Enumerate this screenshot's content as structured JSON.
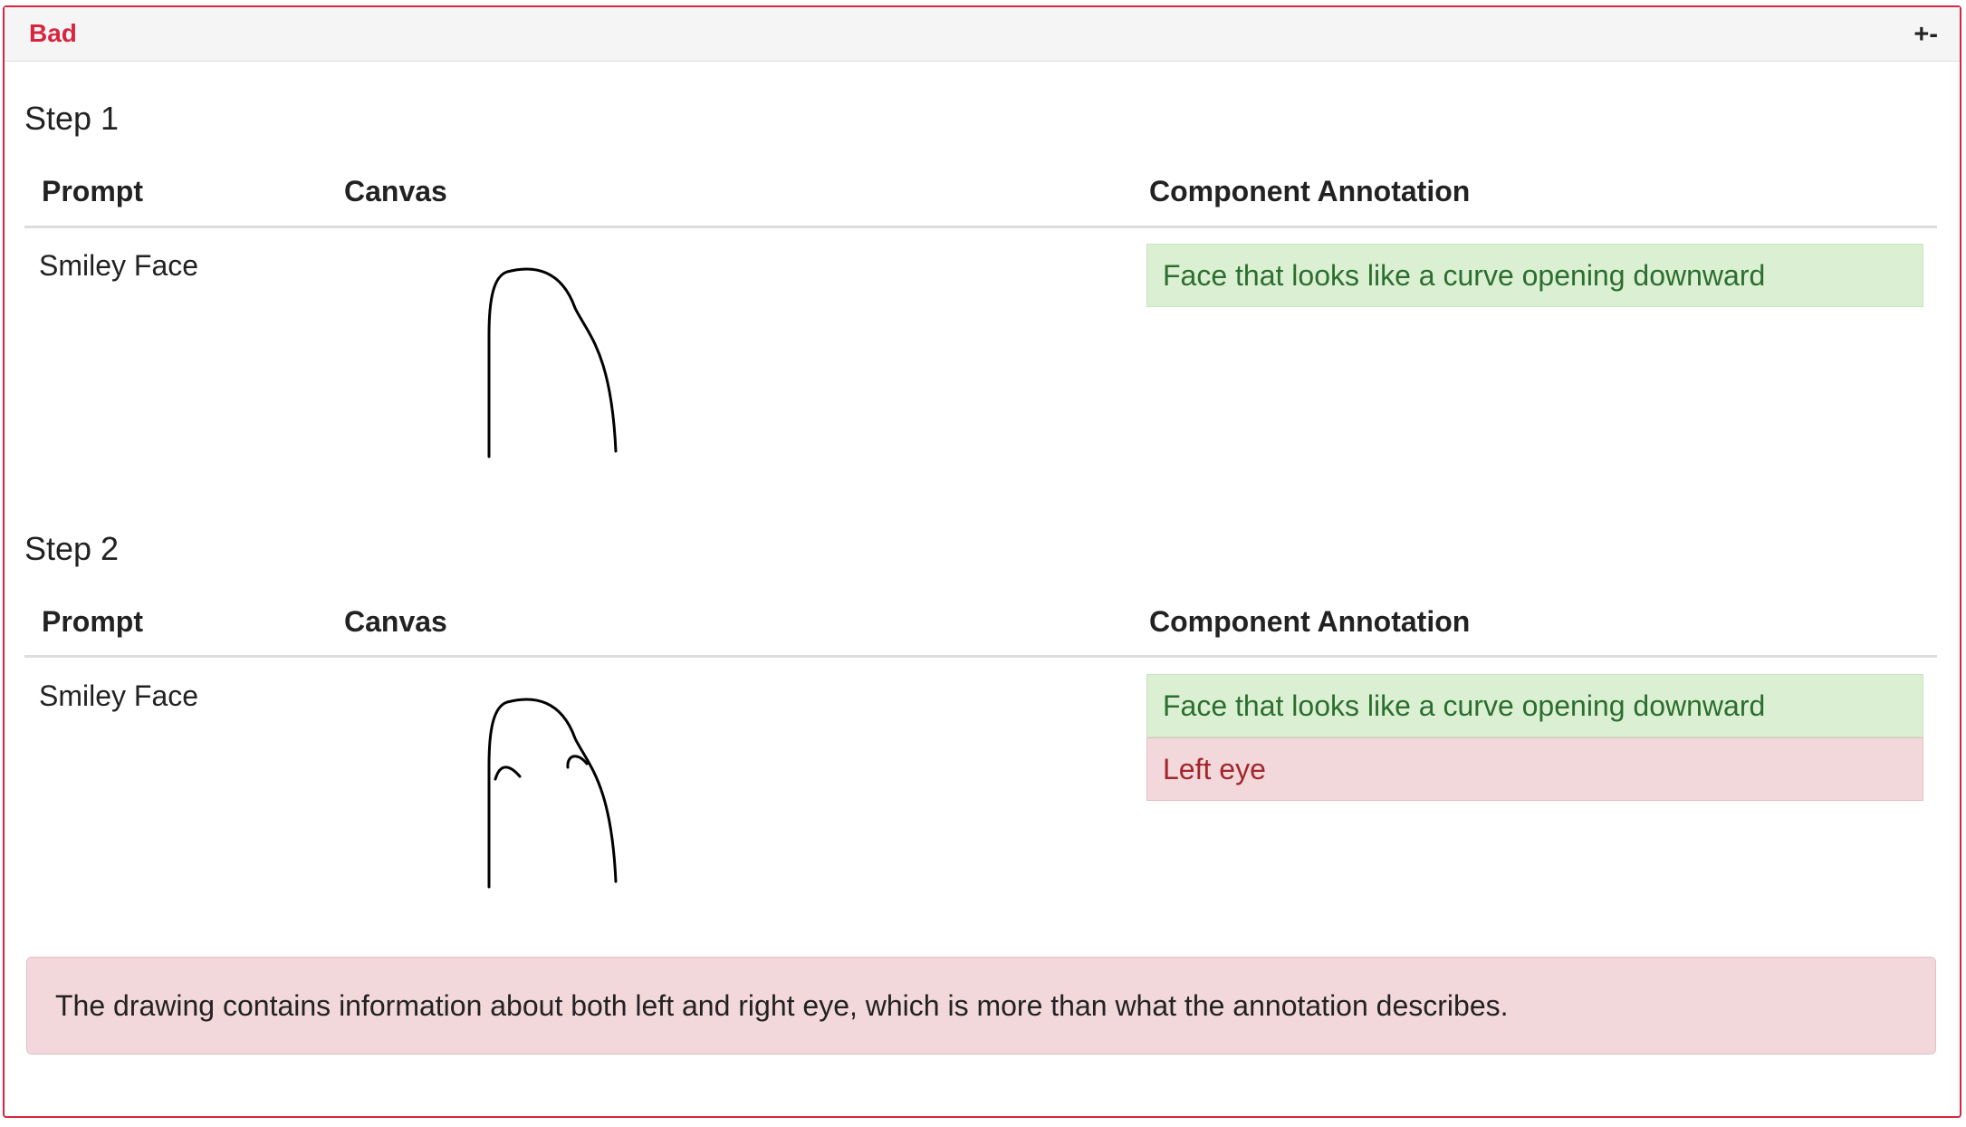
{
  "panel": {
    "title": "Bad",
    "toggle_label": "+-",
    "accent_color": "#d6263f"
  },
  "table_headers": {
    "prompt": "Prompt",
    "canvas": "Canvas",
    "annotation": "Component Annotation"
  },
  "steps": [
    {
      "title": "Step 1",
      "prompt": "Smiley Face",
      "annotations": [
        {
          "text": "Face that looks like a curve opening downward",
          "status": "good"
        }
      ]
    },
    {
      "title": "Step 2",
      "prompt": "Smiley Face",
      "annotations": [
        {
          "text": "Face that looks like a curve opening downward",
          "status": "good"
        },
        {
          "text": "Left eye",
          "status": "bad"
        }
      ]
    }
  ],
  "feedback": "The drawing contains information about both left and right eye, which is more than what the annotation describes.",
  "colors": {
    "good_bg": "#dbf0d3",
    "good_text": "#2c6e2f",
    "bad_bg": "#f2d8db",
    "bad_text": "#a3262b"
  }
}
